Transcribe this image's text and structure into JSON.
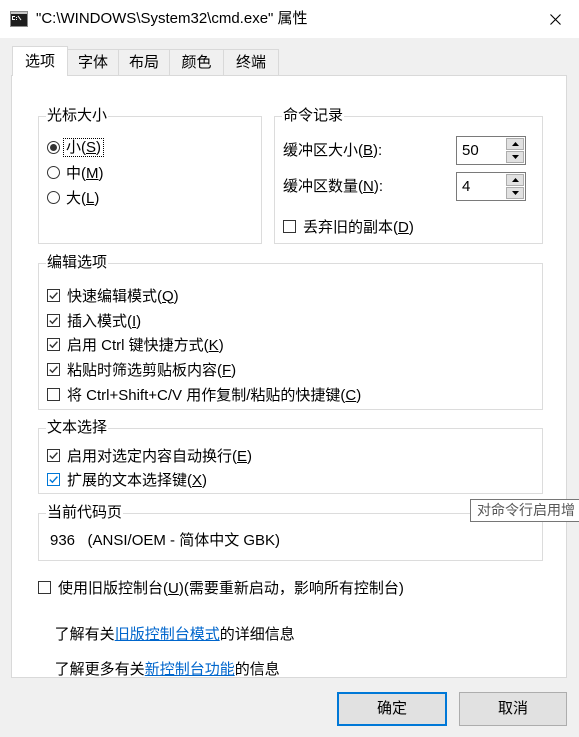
{
  "window": {
    "title": "\"C:\\WINDOWS\\System32\\cmd.exe\" 属性",
    "app_icon": "cmd-icon",
    "close_icon": "close-icon"
  },
  "tabs": [
    {
      "label": "选项",
      "active": true
    },
    {
      "label": "字体",
      "active": false
    },
    {
      "label": "布局",
      "active": false
    },
    {
      "label": "颜色",
      "active": false
    },
    {
      "label": "终端",
      "active": false
    }
  ],
  "cursor_size": {
    "title": "光标大小",
    "options": [
      {
        "label": "小(S)",
        "selected": true
      },
      {
        "label": "中(M)",
        "selected": false
      },
      {
        "label": "大(L)",
        "selected": false
      }
    ]
  },
  "command_history": {
    "title": "命令记录",
    "buffer_size": {
      "label": "缓冲区大小(B):",
      "value": "50"
    },
    "buffer_count": {
      "label": "缓冲区数量(N):",
      "value": "4"
    },
    "discard_old_duplicates": {
      "label": "丢弃旧的副本(D)",
      "checked": false
    }
  },
  "edit_options": {
    "title": "编辑选项",
    "items": [
      {
        "label": "快速编辑模式(Q)",
        "checked": true
      },
      {
        "label": "插入模式(I)",
        "checked": true
      },
      {
        "label": "启用 Ctrl 键快捷方式(K)",
        "checked": true
      },
      {
        "label": "粘贴时筛选剪贴板内容(F)",
        "checked": true
      },
      {
        "label": "将 Ctrl+Shift+C/V 用作复制/粘贴的快捷键(C)",
        "checked": false
      }
    ]
  },
  "text_selection": {
    "title": "文本选择",
    "items": [
      {
        "label": "启用对选定内容自动换行(E)",
        "checked": true
      },
      {
        "label": "扩展的文本选择键(X)",
        "checked": true
      }
    ]
  },
  "tooltip": {
    "text": "对命令行启用增"
  },
  "code_page": {
    "title": "当前代码页",
    "value": "936   (ANSI/OEM - 简体中文 GBK)"
  },
  "legacy_console": {
    "label": "使用旧版控制台(U)(需要重新启动，影响所有控制台)",
    "checked": false
  },
  "info_links": [
    {
      "before": "了解有关",
      "link": "旧版控制台模式",
      "after": "的详细信息"
    },
    {
      "before": "了解更多有关",
      "link": "新控制台功能",
      "after": "的信息"
    }
  ],
  "buttons": {
    "ok": "确定",
    "cancel": "取消"
  },
  "colors": {
    "accent": "#0078d7",
    "link": "#0066cc",
    "tooltip_text": "#575757"
  }
}
